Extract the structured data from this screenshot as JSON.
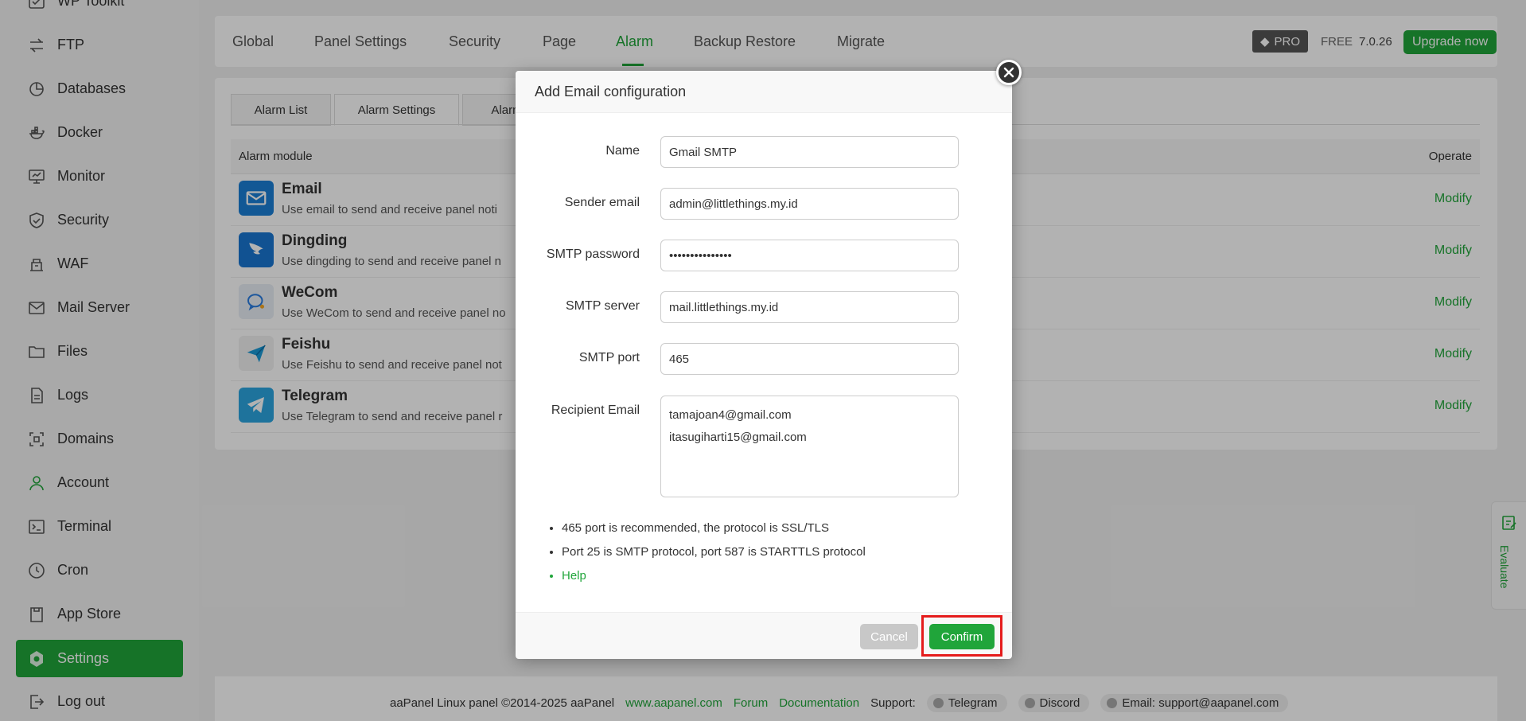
{
  "sidebar": {
    "items": [
      {
        "label": "WP Toolkit",
        "icon": "wp-toolkit-icon"
      },
      {
        "label": "FTP",
        "icon": "ftp-icon"
      },
      {
        "label": "Databases",
        "icon": "databases-icon"
      },
      {
        "label": "Docker",
        "icon": "docker-icon"
      },
      {
        "label": "Monitor",
        "icon": "monitor-icon"
      },
      {
        "label": "Security",
        "icon": "shield-icon"
      },
      {
        "label": "WAF",
        "icon": "waf-icon"
      },
      {
        "label": "Mail Server",
        "icon": "mail-icon"
      },
      {
        "label": "Files",
        "icon": "folder-icon"
      },
      {
        "label": "Logs",
        "icon": "logs-icon"
      },
      {
        "label": "Domains",
        "icon": "domains-icon"
      },
      {
        "label": "Account",
        "icon": "user-icon"
      },
      {
        "label": "Terminal",
        "icon": "terminal-icon"
      },
      {
        "label": "Cron",
        "icon": "clock-icon"
      },
      {
        "label": "App Store",
        "icon": "app-store-icon"
      },
      {
        "label": "Settings",
        "icon": "gear-icon",
        "active": true
      },
      {
        "label": "Log out",
        "icon": "logout-icon"
      }
    ]
  },
  "header": {
    "tabs": [
      "Global",
      "Panel Settings",
      "Security",
      "Page",
      "Alarm",
      "Backup Restore",
      "Migrate"
    ],
    "active_tab": "Alarm",
    "pro_label": "PRO",
    "free_label": "FREE",
    "version": "7.0.26",
    "upgrade_label": "Upgrade now"
  },
  "alarm": {
    "subtabs": [
      "Alarm List",
      "Alarm Settings",
      "Alarm"
    ],
    "active_subtab": "Alarm Settings",
    "table_headers": {
      "module": "Alarm module",
      "operate": "Operate"
    },
    "rows": [
      {
        "name": "Email",
        "desc": "Use email to send and receive panel noti",
        "op": "Modify",
        "color": "#1a7fd6",
        "icon": "email-icon"
      },
      {
        "name": "Dingding",
        "desc": "Use dingding to send and receive panel n",
        "op": "Modify",
        "color": "#1976d2",
        "icon": "dingding-icon"
      },
      {
        "name": "WeCom",
        "desc": "Use WeCom to send and receive panel no",
        "op": "Modify",
        "color": "#e8eef5",
        "icon": "wecom-icon"
      },
      {
        "name": "Feishu",
        "desc": "Use Feishu to send and receive panel not",
        "op": "Modify",
        "color": "#f1f1f1",
        "icon": "feishu-icon"
      },
      {
        "name": "Telegram",
        "desc": "Use Telegram to send and receive panel r",
        "op": "Modify",
        "color": "#2ca5e0",
        "icon": "telegram-icon"
      }
    ]
  },
  "footer": {
    "copyright": "aaPanel Linux panel ©2014-2025 aaPanel",
    "links": [
      "www.aapanel.com",
      "Forum",
      "Documentation"
    ],
    "support_label": "Support:",
    "support_items": [
      "Telegram",
      "Discord",
      "Email: support@aapanel.com"
    ]
  },
  "evaluate_label": "Evaluate",
  "modal": {
    "title": "Add Email configuration",
    "fields": {
      "name": {
        "label": "Name",
        "value": "Gmail SMTP"
      },
      "sender": {
        "label": "Sender email",
        "value": "admin@littlethings.my.id"
      },
      "password": {
        "label": "SMTP password",
        "value": "•••••••••••••••"
      },
      "server": {
        "label": "SMTP server",
        "value": "mail.littlethings.my.id"
      },
      "port": {
        "label": "SMTP port",
        "value": "465"
      },
      "recipient": {
        "label": "Recipient Email",
        "value": "tamajoan4@gmail.com\nitasugiharti15@gmail.com"
      }
    },
    "tips": [
      "465 port is recommended, the protocol is SSL/TLS",
      "Port 25 is SMTP protocol, port 587 is STARTTLS protocol",
      "Help"
    ],
    "cancel_label": "Cancel",
    "confirm_label": "Confirm"
  },
  "colors": {
    "accent": "#20a53a",
    "highlight": "#e51c1c"
  }
}
